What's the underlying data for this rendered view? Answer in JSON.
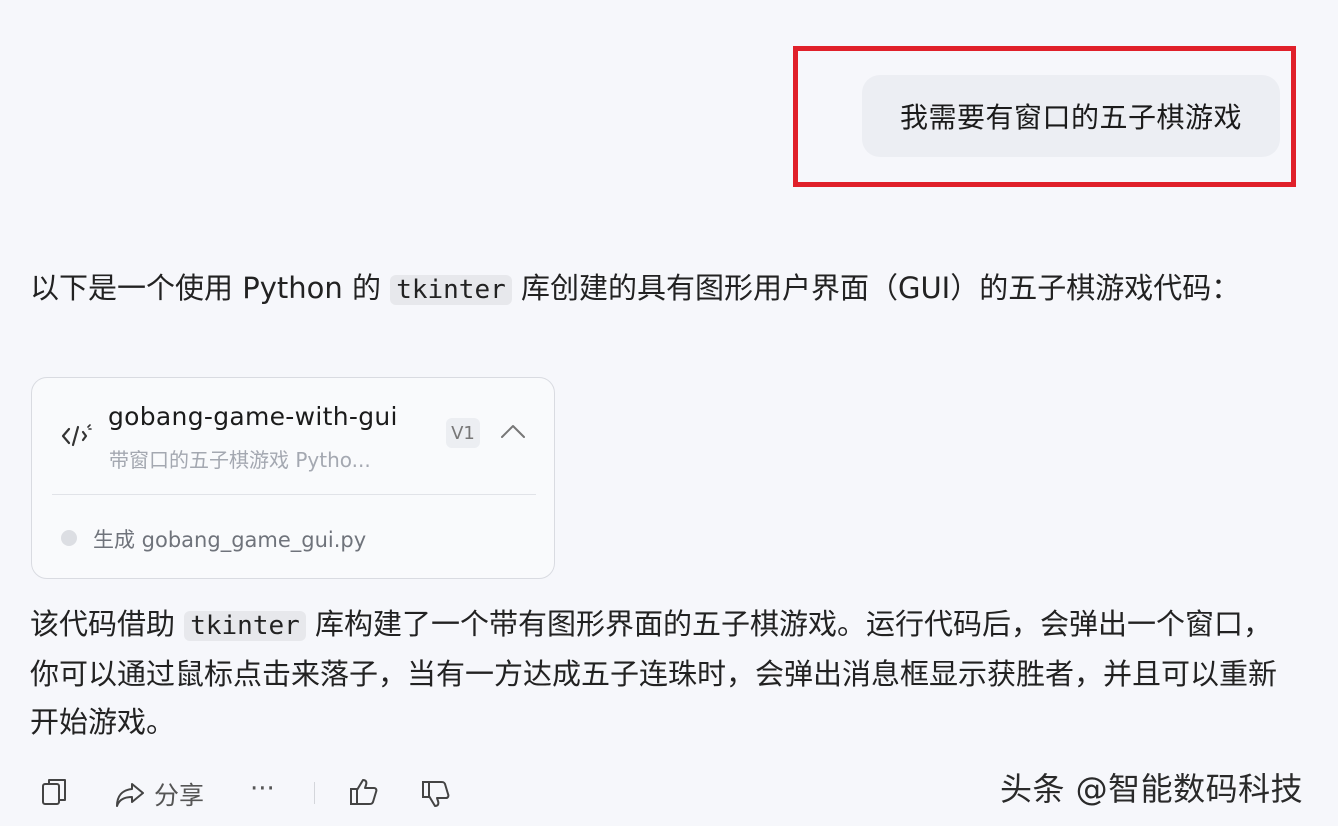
{
  "user_message": "我需要有窗口的五子棋游戏",
  "reply": {
    "intro_before": "以下是一个使用 Python 的 ",
    "intro_code": "tkinter",
    "intro_after": " 库创建的具有图形用户界面（GUI）的五子棋游戏代码：",
    "artifact": {
      "icon": "code-icon",
      "title": "gobang-game-with-gui",
      "subtitle": "带窗口的五子棋游戏 Pytho...",
      "version": "V1",
      "footer": "生成 gobang_game_gui.py"
    },
    "summary_before": "该代码借助 ",
    "summary_code": "tkinter",
    "summary_after": " 库构建了一个带有图形界面的五子棋游戏。运行代码后，会弹出一个窗口，你可以通过鼠标点击来落子，当有一方达成五子连珠时，会弹出消息框显示获胜者，并且可以重新开始游戏。"
  },
  "toolbar": {
    "share_label": "分享",
    "more_label": "···"
  },
  "watermark": "头条 @智能数码科技",
  "colors": {
    "highlight": "#e0202a",
    "bubble": "#eceef3",
    "background": "#f6f7fb"
  }
}
